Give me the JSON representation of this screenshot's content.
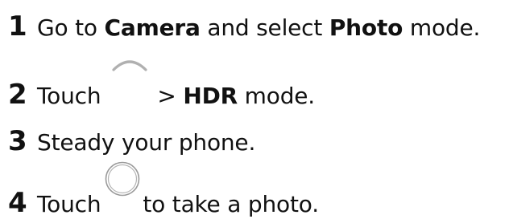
{
  "steps": [
    {
      "number": "1",
      "parts": [
        "Go to ",
        "Camera",
        " and select ",
        "Photo",
        " mode."
      ]
    },
    {
      "number": "2",
      "parts": [
        "Touch",
        "> ",
        "HDR",
        " mode."
      ],
      "icon": "chevron-up-icon"
    },
    {
      "number": "3",
      "parts": [
        "Steady your phone."
      ]
    },
    {
      "number": "4",
      "parts": [
        "Touch",
        "to take a photo."
      ],
      "icon": "shutter-button-icon"
    }
  ]
}
